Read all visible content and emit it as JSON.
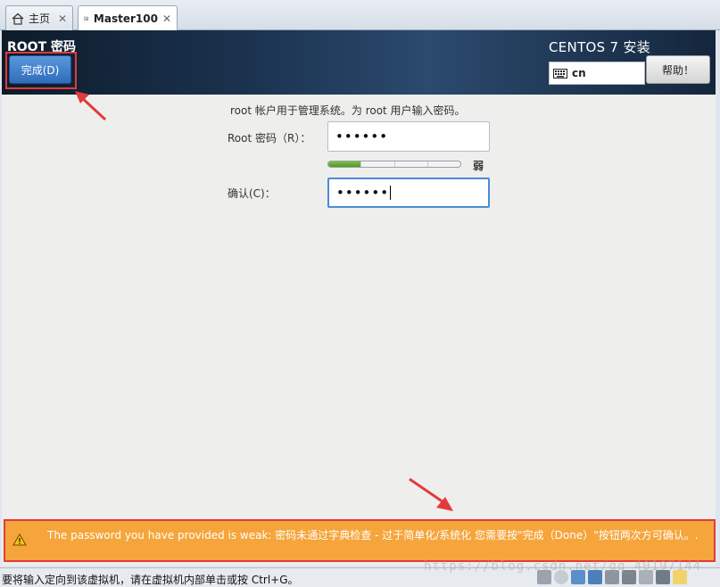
{
  "tabs": [
    {
      "label": "主页",
      "icon": "home-icon"
    },
    {
      "label": "Master100",
      "icon": "vm-icon",
      "active": true
    }
  ],
  "header": {
    "title": "ROOT 密码",
    "done_label": "完成(D)",
    "product": "CENTOS 7 安装",
    "keyboard_layout": "cn",
    "help_label": "帮助！"
  },
  "form": {
    "description": "root 帐户用于管理系统。为 root 用户输入密码。",
    "password_label": "Root 密码（R）：",
    "password_value": "••••••",
    "confirm_label": "确认(C)：",
    "confirm_value": "••••••",
    "strength_text": "弱",
    "strength_level": 0.25
  },
  "warning": {
    "text": "The password you have provided is weak: 密码未通过字典检查 - 过于简单化/系统化 您需要按\"完成（Done）\"按钮两次方可确认。."
  },
  "status": {
    "text": "要将输入定向到该虚拟机，请在虚拟机内部单击或按 Ctrl+G。"
  },
  "watermark": "https://blog.csdn.net/qq_40197144",
  "colors": {
    "header_dark": "#14263c",
    "done_blue": "#2f6dbb",
    "warning_orange": "#f5a53b",
    "annotation_red": "#e23b3b",
    "meter_green": "#4f9a23"
  }
}
